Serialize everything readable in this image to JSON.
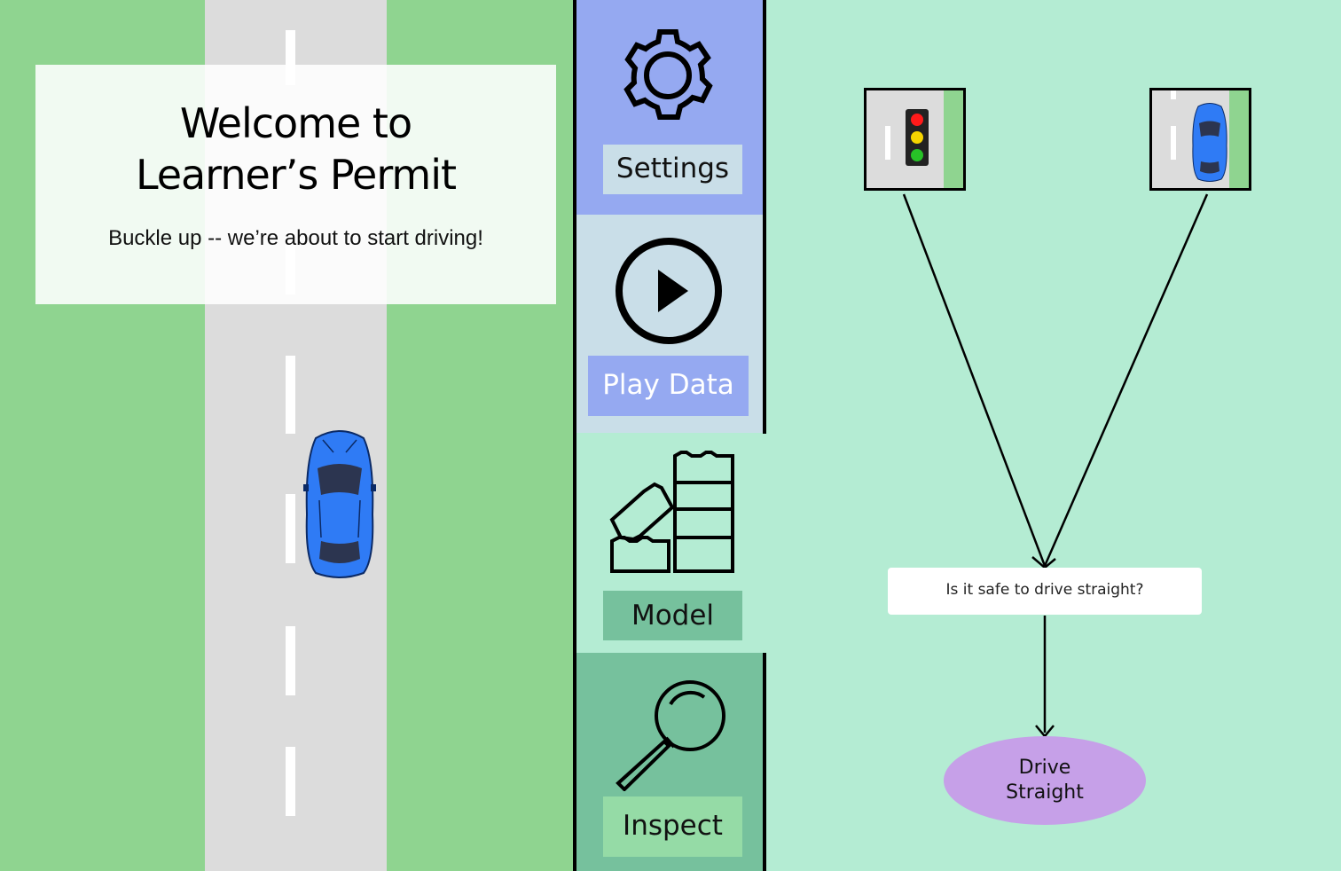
{
  "welcome": {
    "title_line1": "Welcome to",
    "title_line2": "Learner’s Permit",
    "subtitle": "Buckle up -- we’re about to start driving!"
  },
  "sidebar": {
    "items": [
      {
        "label": "Settings",
        "icon": "gear-icon"
      },
      {
        "label": "Play Data",
        "icon": "play-icon"
      },
      {
        "label": "Model",
        "icon": "blocks-icon"
      },
      {
        "label": "Inspect",
        "icon": "magnifier-icon"
      }
    ]
  },
  "tree": {
    "features": [
      {
        "name": "traffic-light-feature",
        "icon": "traffic-light-icon"
      },
      {
        "name": "car-ahead-feature",
        "icon": "car-icon"
      }
    ],
    "question": "Is it safe to drive straight?",
    "leaf_line1": "Drive",
    "leaf_line2": "Straight"
  },
  "colors": {
    "grass": "#8fd490",
    "road": "#dcdcdc",
    "car": "#2f7bf5",
    "settings_tab": "#95a9f1",
    "play_tab": "#c9dee8",
    "model_tab": "#b4ecd3",
    "inspect_tab": "#76c19d",
    "leaf": "#c6a0e8"
  }
}
